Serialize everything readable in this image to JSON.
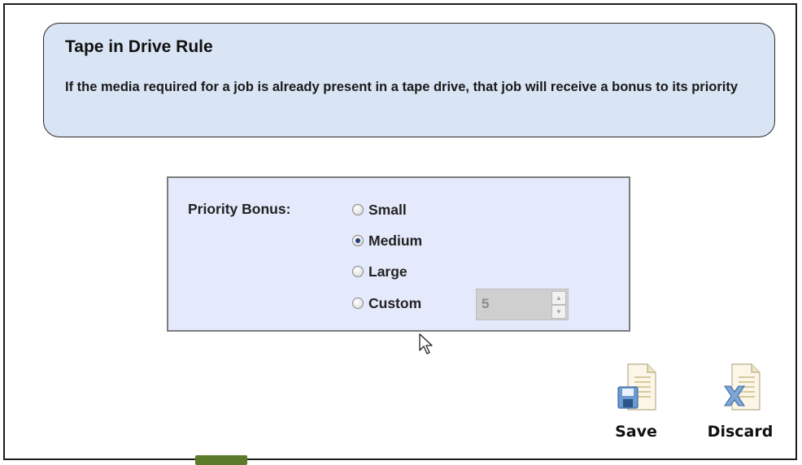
{
  "info_card": {
    "title": "Tape in Drive Rule",
    "description": "If the media required for a job is already present in a tape drive, that job will receive a bonus to its priority"
  },
  "priority": {
    "label": "Priority Bonus:",
    "options": [
      {
        "label": "Small",
        "selected": false
      },
      {
        "label": "Medium",
        "selected": true
      },
      {
        "label": "Large",
        "selected": false
      },
      {
        "label": "Custom",
        "selected": false
      }
    ],
    "custom_value": "5",
    "custom_enabled": false
  },
  "actions": {
    "save_label": "Save",
    "discard_label": "Discard"
  },
  "icons": {
    "save": "save-document-icon",
    "discard": "discard-document-icon",
    "cursor": "mouse-pointer-icon"
  },
  "colors": {
    "info_card_bg": "#d9e4f4",
    "panel_bg": "#e4e9fb",
    "radio_checked": "#1f3f7a"
  }
}
